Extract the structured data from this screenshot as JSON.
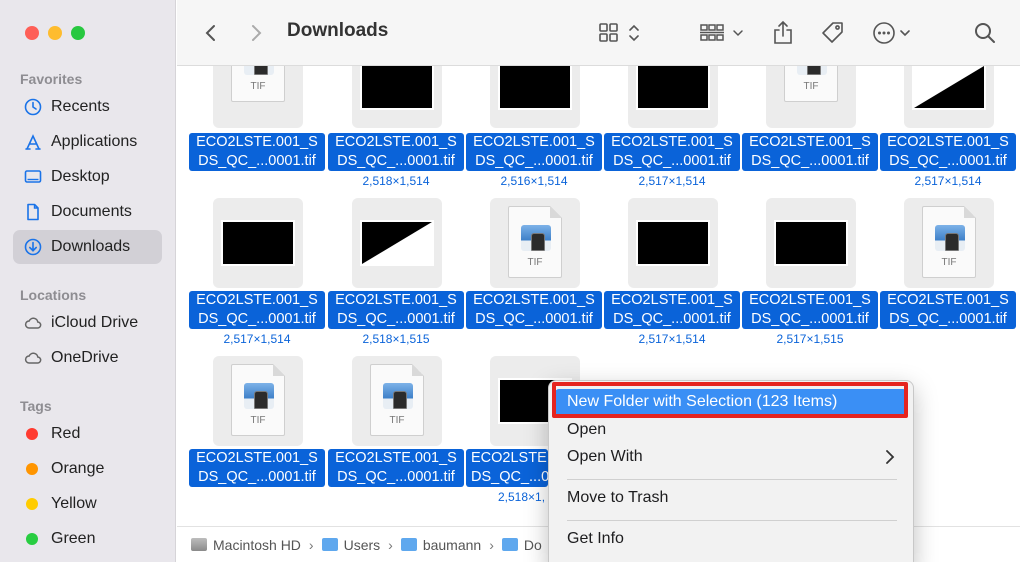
{
  "window": {
    "title": "Downloads"
  },
  "sidebar": {
    "favorites_title": "Favorites",
    "favorites": [
      {
        "label": "Recents",
        "icon": "clock-icon"
      },
      {
        "label": "Applications",
        "icon": "applications-icon"
      },
      {
        "label": "Desktop",
        "icon": "desktop-icon"
      },
      {
        "label": "Documents",
        "icon": "document-icon"
      },
      {
        "label": "Downloads",
        "icon": "download-icon",
        "selected": true
      }
    ],
    "locations_title": "Locations",
    "locations": [
      {
        "label": "iCloud Drive",
        "icon": "cloud-icon"
      },
      {
        "label": "OneDrive",
        "icon": "cloud-icon"
      }
    ],
    "tags_title": "Tags",
    "tags": [
      {
        "label": "Red",
        "color": "#ff3b30"
      },
      {
        "label": "Orange",
        "color": "#ff9500"
      },
      {
        "label": "Yellow",
        "color": "#ffcc00"
      },
      {
        "label": "Green",
        "color": "#28cd41"
      }
    ]
  },
  "files": {
    "name_line1": "ECO2LSTE.001_S",
    "name_line2": "DS_QC_...0001.tif",
    "name_line1_partial": "ECO2LSTE",
    "name_line2_partial": "DS_QC_...0",
    "tif_label": "TIF",
    "row1_dims": [
      "",
      "2,518×1,514",
      "2,516×1,514",
      "2,517×1,514",
      "",
      "2,517×1,514"
    ],
    "row2_dims": [
      "2,517×1,514",
      "2,518×1,515",
      "",
      "2,517×1,514",
      "2,517×1,515",
      ""
    ],
    "row3_dims": [
      "",
      "",
      "2,518×1,"
    ]
  },
  "pathbar": {
    "items": [
      "Macintosh HD",
      "Users",
      "baumann",
      "Do"
    ],
    "separator": "›"
  },
  "context_menu": {
    "items": [
      {
        "label": "New Folder with Selection (123 Items)",
        "highlighted": true
      },
      {
        "label": "Open"
      },
      {
        "label": "Open With",
        "submenu": true
      },
      {
        "label": "Move to Trash"
      },
      {
        "label": "Get Info"
      }
    ]
  }
}
